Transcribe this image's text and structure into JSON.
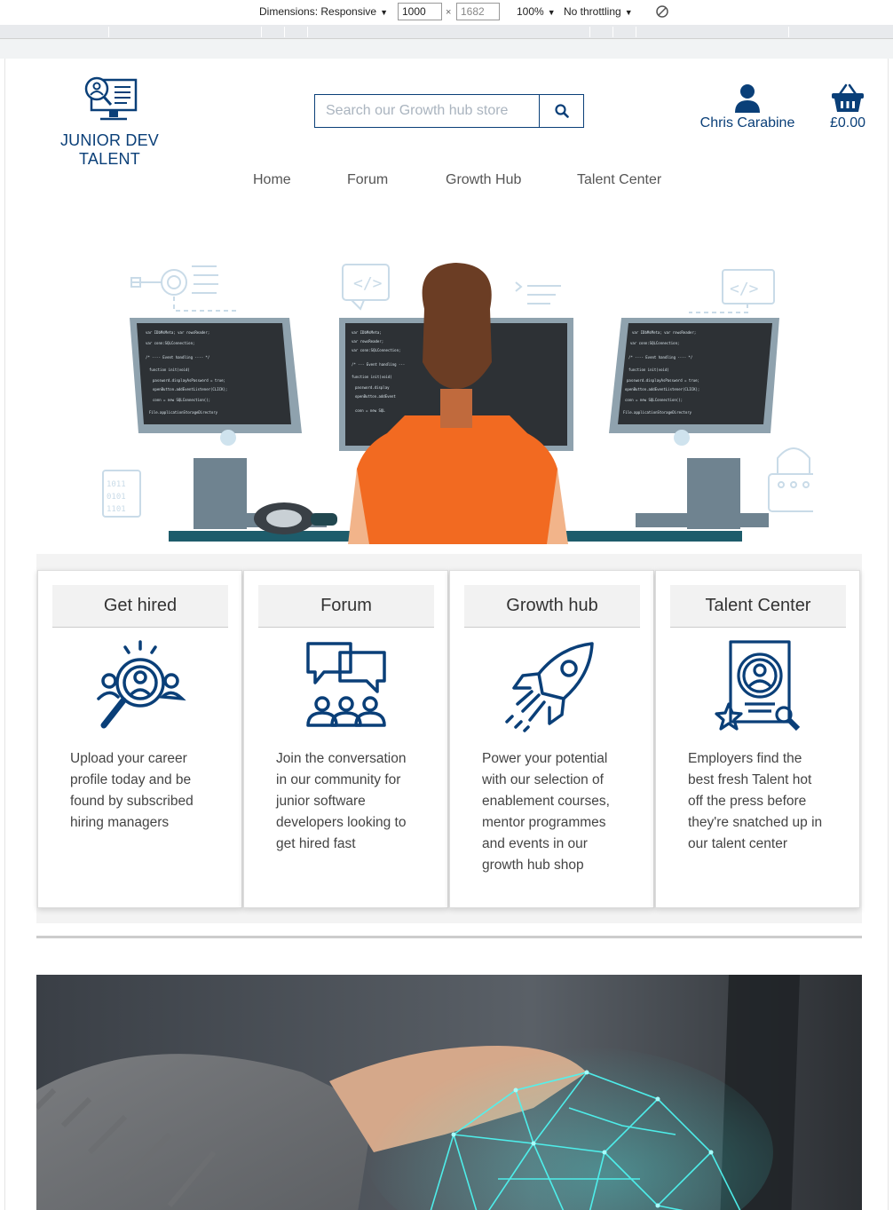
{
  "devtools": {
    "dimensions_label": "Dimensions: Responsive",
    "width_value": "1000",
    "times": "×",
    "height_value": "1682",
    "zoom": "100%",
    "throttling": "No throttling"
  },
  "header": {
    "logo_text": "JUNIOR DEV TALENT",
    "search_placeholder": "Search our Growth hub store",
    "account_name": "Chris Carabine",
    "cart_total": "£0.00"
  },
  "nav": [
    "Home",
    "Forum",
    "Growth Hub",
    "Talent Center"
  ],
  "cards": [
    {
      "title": "Get hired",
      "icon": "job-search-icon",
      "text": "Upload your career profile today and be found by subscribed hiring managers"
    },
    {
      "title": "Forum",
      "icon": "community-chat-icon",
      "text": "Join the conversation in our community for junior software developers looking to get hired fast"
    },
    {
      "title": "Growth hub",
      "icon": "rocket-icon",
      "text": "Power your potential with our selection of enablement courses, mentor programmes and events in our growth hub shop"
    },
    {
      "title": "Talent Center",
      "icon": "talent-profile-icon",
      "text": "Employers find the best fresh Talent hot off the press before they're snatched up in our talent center"
    }
  ],
  "colors": {
    "brand": "#0a3f78",
    "hero_orange": "#f26a21",
    "hero_desk": "#1d5c6b",
    "handshake_glow": "#4ef4f0"
  }
}
